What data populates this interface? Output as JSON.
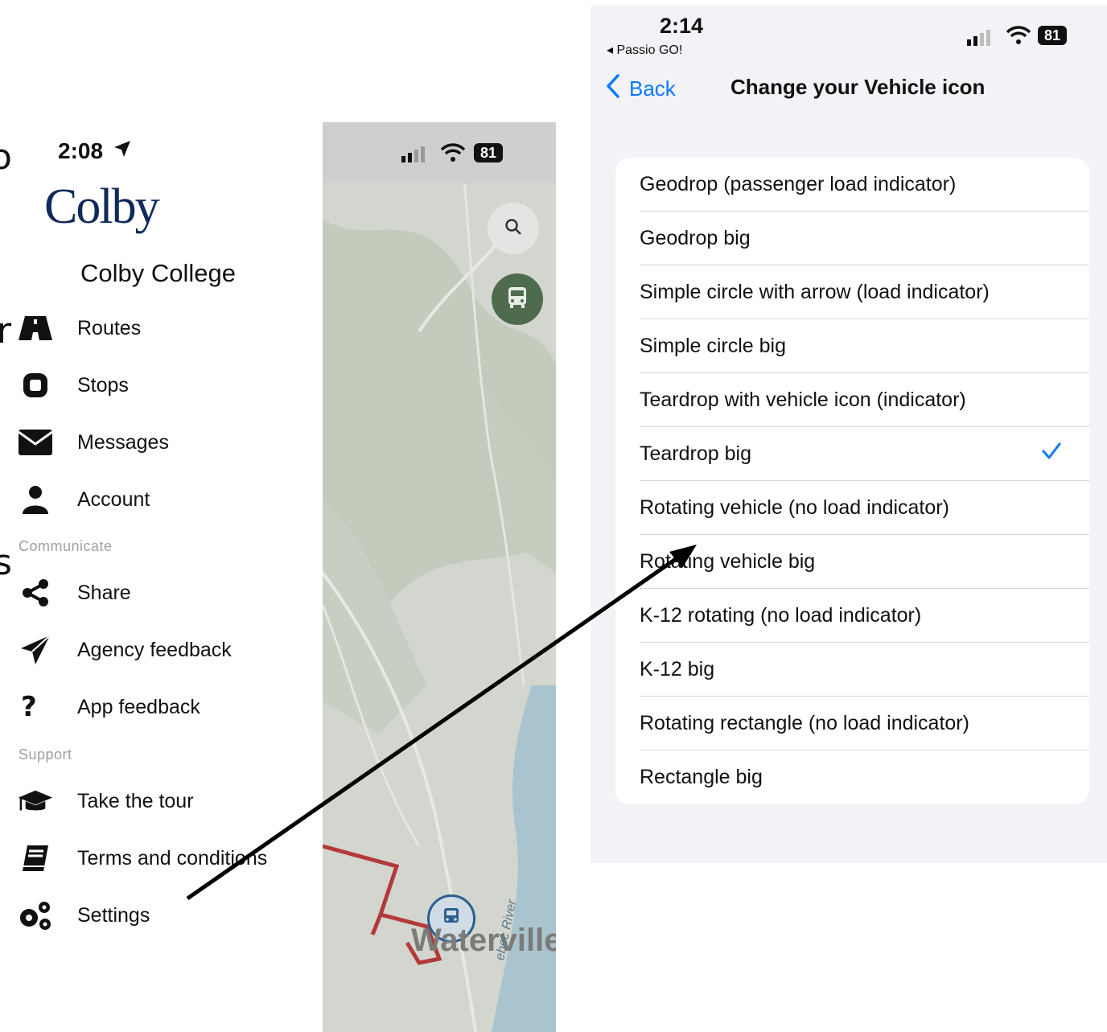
{
  "left_panel": {
    "clipped_chars": [
      "o",
      "r",
      "s"
    ],
    "status_time": "2:08",
    "logo_text": "Colby",
    "org_name": "Colby College",
    "main_items": [
      {
        "label": "Routes",
        "icon": "road-icon"
      },
      {
        "label": "Stops",
        "icon": "stop-icon"
      },
      {
        "label": "Messages",
        "icon": "envelope-icon"
      },
      {
        "label": "Account",
        "icon": "user-icon"
      }
    ],
    "communicate_header": "Communicate",
    "communicate_items": [
      {
        "label": "Share",
        "icon": "share-icon"
      },
      {
        "label": "Agency feedback",
        "icon": "paper-plane-icon"
      },
      {
        "label": "App feedback",
        "icon": "question-icon"
      }
    ],
    "support_header": "Support",
    "support_items": [
      {
        "label": "Take the tour",
        "icon": "graduation-cap-icon"
      },
      {
        "label": "Terms and conditions",
        "icon": "book-icon"
      },
      {
        "label": "Settings",
        "icon": "gears-icon"
      }
    ]
  },
  "map": {
    "battery": "81",
    "city_label": "Waterville",
    "river_label": "ebec River"
  },
  "phone": {
    "status_time": "2:14",
    "back_app": "◂ Passio GO!",
    "battery": "81",
    "back_label": "Back",
    "title": "Change your Vehicle icon",
    "options": [
      {
        "label": "Geodrop (passenger load indicator)",
        "selected": false
      },
      {
        "label": "Geodrop big",
        "selected": false
      },
      {
        "label": "Simple circle with arrow (load indicator)",
        "selected": false
      },
      {
        "label": "Simple circle big",
        "selected": false
      },
      {
        "label": "Teardrop with vehicle icon (indicator)",
        "selected": false
      },
      {
        "label": "Teardrop big",
        "selected": true
      },
      {
        "label": "Rotating vehicle (no load indicator)",
        "selected": false
      },
      {
        "label": "Rotating vehicle big",
        "selected": false
      },
      {
        "label": "K-12 rotating (no load indicator)",
        "selected": false
      },
      {
        "label": "K-12 big",
        "selected": false
      },
      {
        "label": "Rotating rectangle (no load indicator)",
        "selected": false
      },
      {
        "label": "Rectangle big",
        "selected": false
      }
    ]
  },
  "colors": {
    "ios_blue": "#0a7aff",
    "logo_navy": "#0f2a5a",
    "route_red": "#b33a3a"
  }
}
